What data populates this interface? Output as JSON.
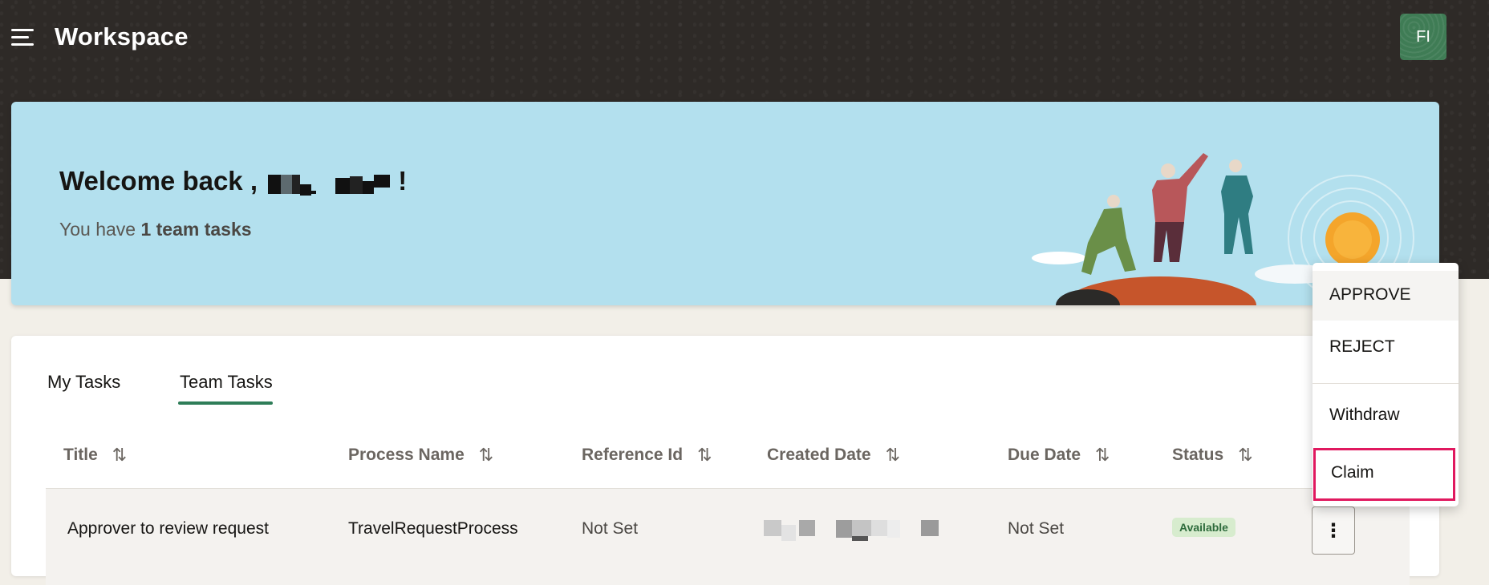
{
  "header": {
    "app_title": "Workspace",
    "avatar_initials": "FI"
  },
  "banner": {
    "welcome_prefix": "Welcome back ,",
    "welcome_suffix": "!",
    "subtext_prefix": "You have ",
    "subtext_bold": "1 team tasks"
  },
  "tabs": [
    {
      "label": "My Tasks",
      "active": false
    },
    {
      "label": "Team Tasks",
      "active": true
    }
  ],
  "table": {
    "columns": [
      "Title",
      "Process Name",
      "Reference Id",
      "Created Date",
      "Due Date",
      "Status"
    ],
    "rows": [
      {
        "title": "Approver to review request",
        "process_name": "TravelRequestProcess",
        "reference_id": "Not Set",
        "due_date": "Not Set",
        "status": "Available"
      }
    ]
  },
  "actions_menu": {
    "items": [
      "APPROVE",
      "REJECT",
      "Withdraw",
      "Claim"
    ]
  },
  "colors": {
    "header_bg": "#2e2a27",
    "banner_bg": "#b3e0ee",
    "accent_green": "#2e7d58",
    "focus_outline": "#e0195f",
    "avatar_bg": "#3f7c55"
  }
}
